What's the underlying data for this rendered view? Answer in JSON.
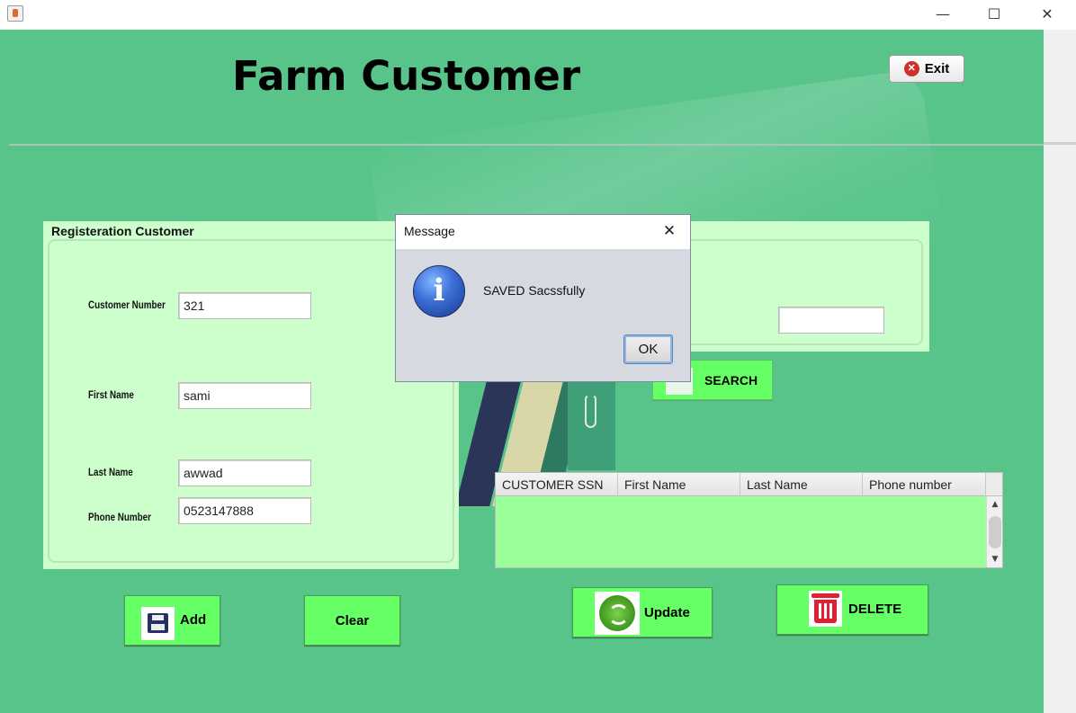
{
  "window": {
    "minimize_glyph": "—",
    "maximize_glyph": "☐",
    "close_glyph": "✕",
    "app_icon": "java-cup-icon"
  },
  "header": {
    "title": "Farm Customer",
    "exit_label": "Exit",
    "exit_icon": "close-circle-icon"
  },
  "registration": {
    "title": "Registeration Customer",
    "fields": {
      "customer_number": {
        "label": "Customer Number",
        "value": "321"
      },
      "first_name": {
        "label": "First Name",
        "value": "sami"
      },
      "last_name": {
        "label": "Last Name",
        "value": "awwad"
      },
      "phone_number": {
        "label": "Phone Number",
        "value": "0523147888"
      }
    }
  },
  "search": {
    "label": "SEARCH",
    "value": "",
    "icon": "search-icon"
  },
  "table": {
    "columns": [
      "CUSTOMER SSN",
      "First Name",
      "Last Name",
      "Phone number"
    ],
    "rows": [],
    "scroll_up": "▲",
    "scroll_down": "▼"
  },
  "actions": {
    "add": {
      "label": "Add",
      "icon": "save-icon"
    },
    "clear": {
      "label": "Clear"
    },
    "update": {
      "label": "Update",
      "icon": "refresh-icon"
    },
    "delete": {
      "label": "DELETE",
      "icon": "trash-icon"
    }
  },
  "dialog": {
    "title": "Message",
    "message": "SAVED Sacssfully",
    "icon_glyph": "i",
    "ok_label": "OK",
    "close_glyph": "✕"
  },
  "colors": {
    "background": "#58c48a",
    "panel": "#ccffcc",
    "button": "#66ff66",
    "table_body": "#99ff99"
  }
}
